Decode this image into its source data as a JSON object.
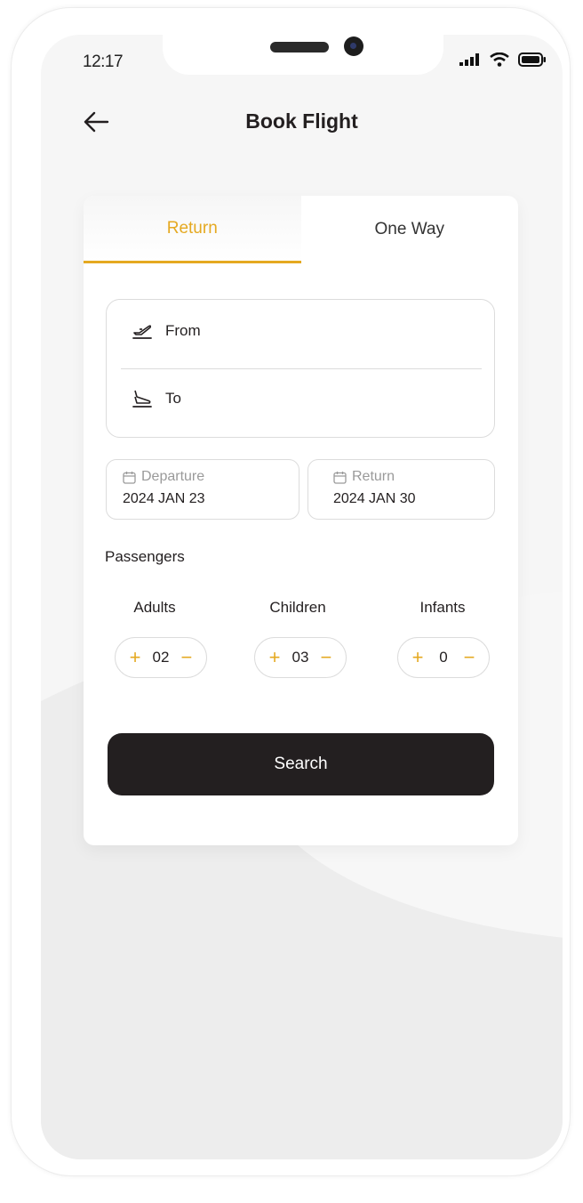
{
  "status_bar": {
    "time": "12:17"
  },
  "header": {
    "title": "Book Flight"
  },
  "tabs": [
    {
      "label": "Return",
      "active": true
    },
    {
      "label": "One Way",
      "active": false
    }
  ],
  "route": {
    "from_label": "From",
    "to_label": "To"
  },
  "dates": {
    "departure": {
      "label": "Departure",
      "value": "2024 JAN 23"
    },
    "return": {
      "label": "Return",
      "value": "2024 JAN 30"
    }
  },
  "passengers": {
    "title": "Passengers",
    "adults": {
      "label": "Adults",
      "value": "02"
    },
    "children": {
      "label": "Children",
      "value": "03"
    },
    "infants": {
      "label": "Infants",
      "value": "0"
    },
    "plus_glyph": "+",
    "minus_glyph": "−"
  },
  "search_button": {
    "label": "Search"
  },
  "colors": {
    "accent": "#e5a921",
    "dark": "#231f20",
    "background": "#f6f6f6"
  }
}
